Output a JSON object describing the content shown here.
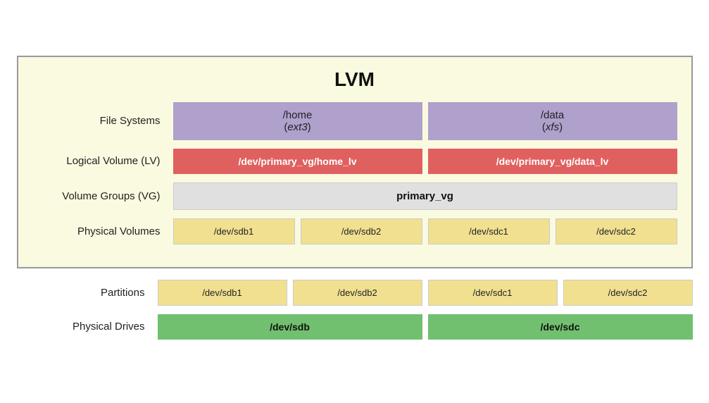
{
  "title": "LVM",
  "lvm_box": {
    "rows": {
      "file_systems": {
        "label": "File Systems",
        "items": [
          {
            "name": "/home",
            "type": "ext3"
          },
          {
            "name": "/data",
            "type": "xfs"
          }
        ]
      },
      "logical_volume": {
        "label": "Logical Volume (LV)",
        "items": [
          "/dev/primary_vg/home_lv",
          "/dev/primary_vg/data_lv"
        ]
      },
      "volume_groups": {
        "label": "Volume Groups (VG)",
        "item": "primary_vg"
      },
      "physical_volumes": {
        "label": "Physical Volumes",
        "items": [
          "/dev/sdb1",
          "/dev/sdb2",
          "/dev/sdc1",
          "/dev/sdc2"
        ]
      }
    }
  },
  "below": {
    "partitions": {
      "label": "Partitions",
      "items": [
        "/dev/sdb1",
        "/dev/sdb2",
        "/dev/sdc1",
        "/dev/sdc2"
      ]
    },
    "physical_drives": {
      "label": "Physical Drives",
      "items": [
        "/dev/sdb",
        "/dev/sdc"
      ]
    }
  }
}
